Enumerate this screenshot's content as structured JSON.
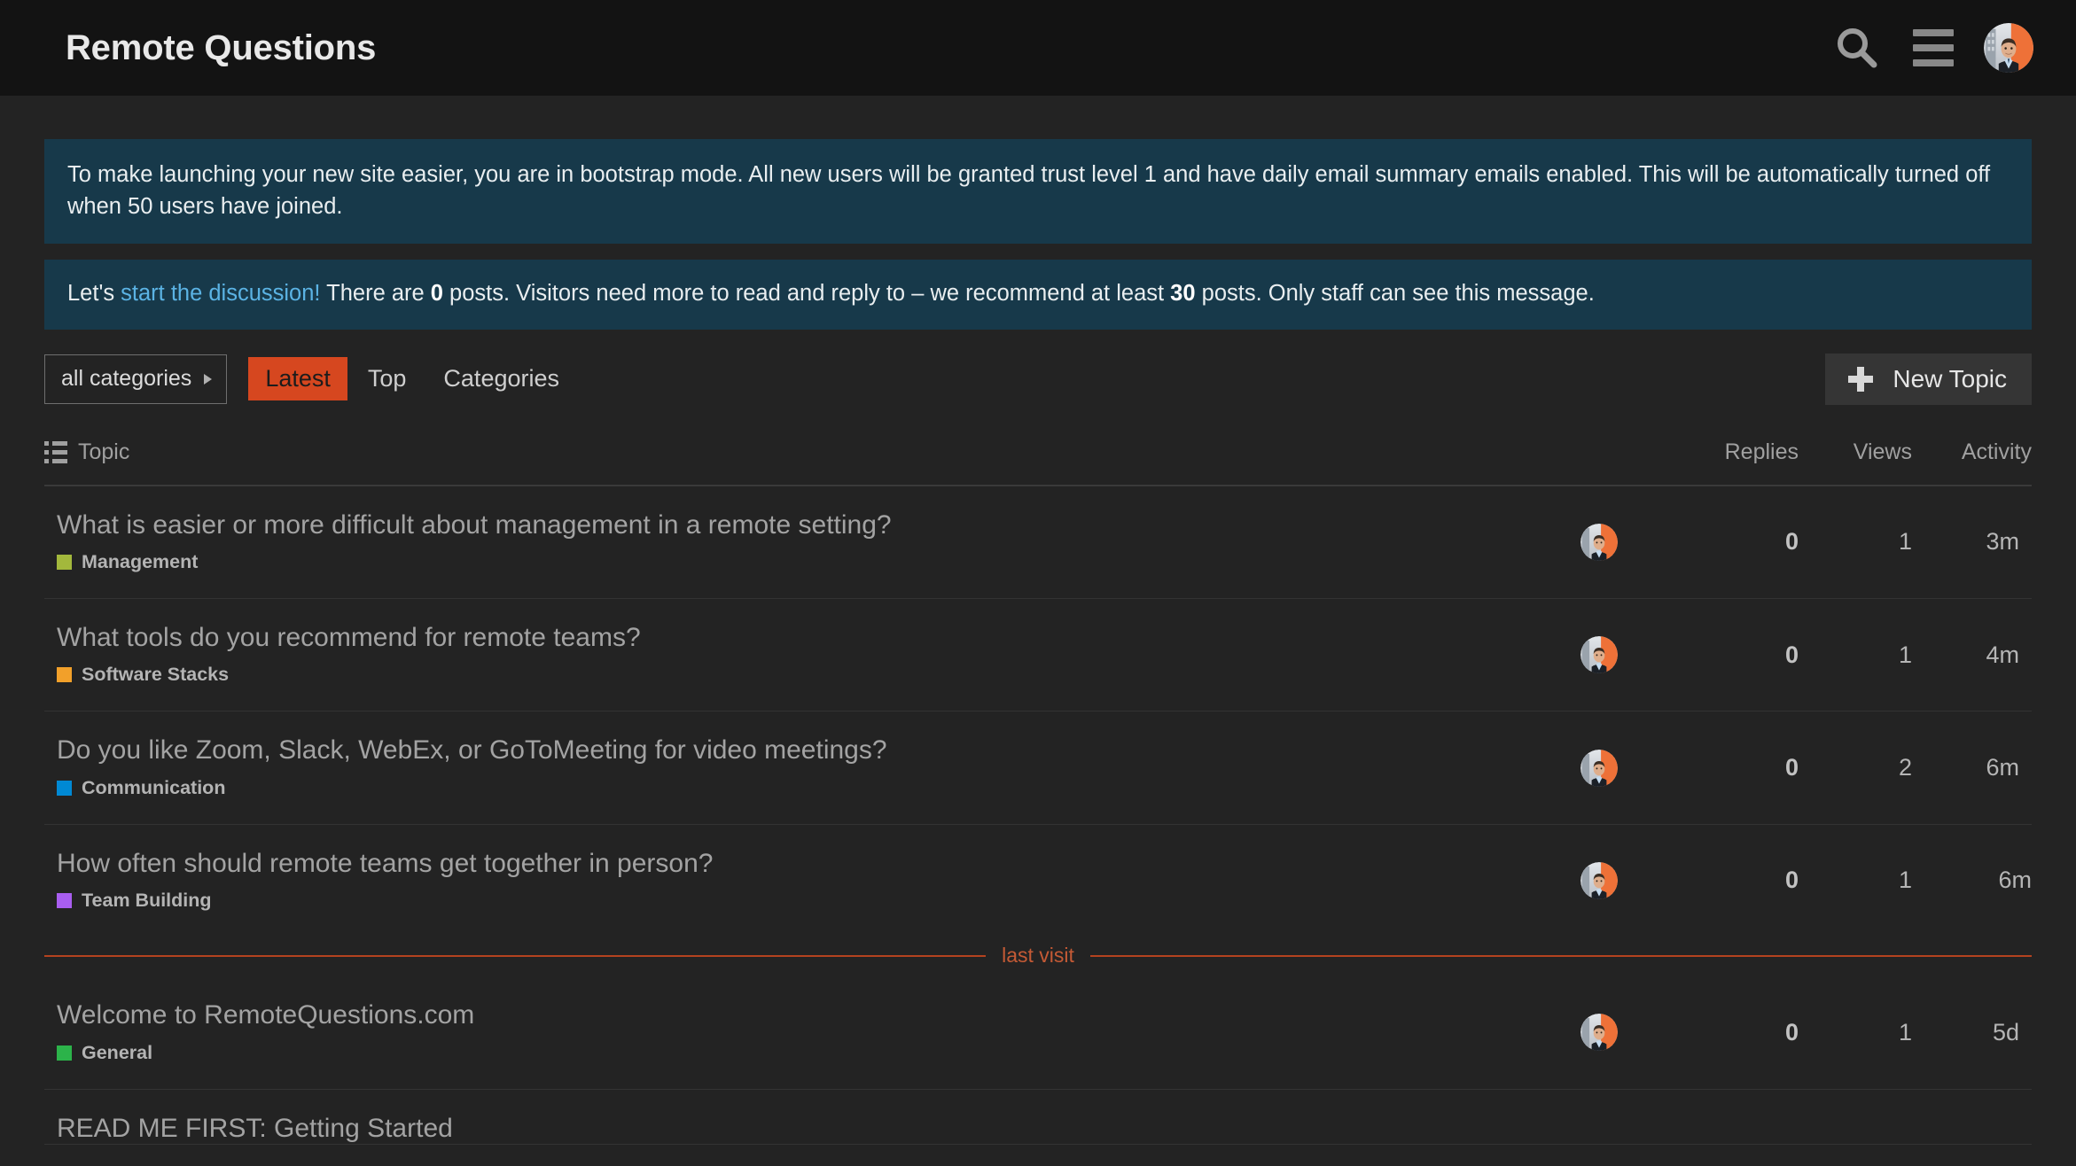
{
  "header": {
    "site_title": "Remote Questions",
    "search_icon": "search-icon",
    "menu_icon": "hamburger-menu-icon",
    "avatar_alt": "user-avatar"
  },
  "banners": [
    {
      "id": "bootstrap-mode-banner",
      "segments": [
        {
          "type": "text",
          "text": "To make launching your new site easier, you are in bootstrap mode. All new users will be granted trust level 1 and have daily email summary emails enabled. This will be automatically turned off when 50 users have joined."
        }
      ],
      "full_text": "To make launching your new site easier, you are in bootstrap mode. All new users will be granted trust level 1 and have daily email summary emails enabled. This will be automatically turned off when 50 users have joined."
    },
    {
      "id": "start-discussion-banner",
      "lead": "Let's ",
      "link": "start the discussion!",
      "mid1": " There are ",
      "count_posts": "0",
      "mid2": " posts. Visitors need more to read and reply to – we recommend at least ",
      "recommended_posts": "30",
      "tail": " posts. Only staff can see this message."
    }
  ],
  "nav": {
    "category_selector": {
      "label": "all categories",
      "caret": "caret-right-icon"
    },
    "links": [
      {
        "label": "Latest",
        "active": true
      },
      {
        "label": "Top",
        "active": false
      },
      {
        "label": "Categories",
        "active": false
      }
    ],
    "new_topic": {
      "label": "New Topic",
      "icon": "plus-icon"
    }
  },
  "table": {
    "headers": {
      "topic": "Topic",
      "topic_icon": "list-icon",
      "replies": "Replies",
      "views": "Views",
      "activity": "Activity"
    },
    "rows": [
      {
        "title": "What is easier or more difficult about management in a remote setting?",
        "category": "Management",
        "category_color": "#a3b83c",
        "replies": "0",
        "views": "1",
        "activity": "3m"
      },
      {
        "title": "What tools do you recommend for remote teams?",
        "category": "Software Stacks",
        "category_color": "#f2a02a",
        "replies": "0",
        "views": "1",
        "activity": "4m"
      },
      {
        "title": "Do you like Zoom, Slack, WebEx, or GoToMeeting for video meetings?",
        "category": "Communication",
        "category_color": "#0089d4",
        "replies": "0",
        "views": "2",
        "activity": "6m"
      },
      {
        "title": "How often should remote teams get together in person?",
        "category": "Team Building",
        "category_color": "#a95ef0",
        "replies": "0",
        "views": "1",
        "activity": "6m"
      },
      {
        "title": "Welcome to RemoteQuestions.com",
        "category": "General",
        "category_color": "#2cb34a",
        "replies": "0",
        "views": "1",
        "activity": "5d"
      },
      {
        "title": "READ ME FIRST: Getting Started",
        "category": "",
        "category_color": "",
        "replies": "",
        "views": "",
        "activity": ""
      }
    ],
    "last_visit_label": "last visit",
    "last_visit_after_row_index": 3
  },
  "colors": {
    "page_background": "#232323",
    "header_background": "#131313",
    "banner_background": "#17394a",
    "accent": "#d6471f",
    "last_visit_line": "#b4421f",
    "link_blue": "#5bb3e4"
  }
}
